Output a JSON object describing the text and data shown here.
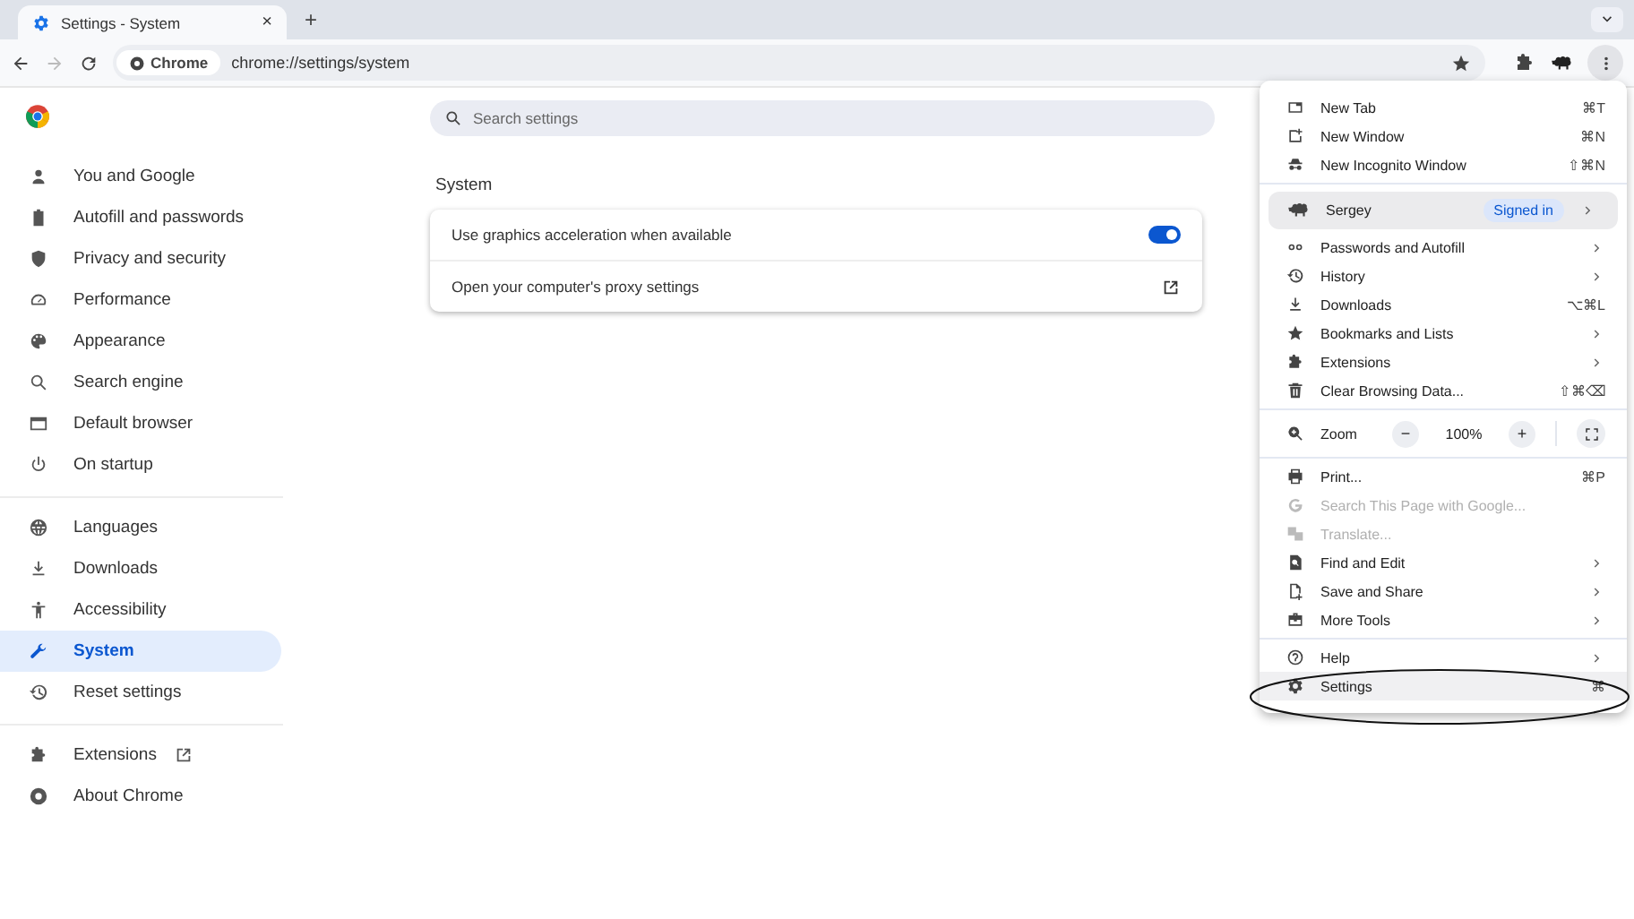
{
  "tabs": [
    {
      "title": "Settings - System",
      "selected": true,
      "close": "×"
    }
  ],
  "new_tab": "+",
  "toolbar": {
    "chip": "Chrome",
    "url": "chrome://settings/system",
    "forward_disabled": true
  },
  "sidebar": {
    "groups": [
      [
        {
          "label": "You and Google",
          "selected": false
        },
        {
          "label": "Autofill and passwords",
          "selected": false
        },
        {
          "label": "Privacy and security",
          "selected": false
        },
        {
          "label": "Performance",
          "selected": false
        },
        {
          "label": "Appearance",
          "selected": false
        },
        {
          "label": "Search engine",
          "selected": false
        },
        {
          "label": "Default browser",
          "selected": false
        },
        {
          "label": "On startup",
          "selected": false
        }
      ],
      [
        {
          "label": "Languages",
          "selected": false
        },
        {
          "label": "Downloads",
          "selected": false
        },
        {
          "label": "Accessibility",
          "selected": false
        },
        {
          "label": "System",
          "selected": true
        },
        {
          "label": "Reset settings",
          "selected": false
        }
      ],
      [
        {
          "label": "Extensions",
          "selected": false,
          "kind": "external"
        },
        {
          "label": "About Chrome",
          "selected": false,
          "kind": "page"
        }
      ]
    ]
  },
  "search": {
    "placeholder": "Search settings"
  },
  "section": {
    "title": "System",
    "rows": [
      {
        "kind": "toggle",
        "label": "Use graphics acceleration when available",
        "on": true
      },
      {
        "kind": "link",
        "label": "Open your computer's proxy settings"
      }
    ]
  },
  "menu": {
    "sections": [
      [
        {
          "kind": "item",
          "label": "New Tab",
          "shortcut": "⌘T"
        },
        {
          "kind": "item",
          "label": "New Window",
          "shortcut": "⌘N"
        },
        {
          "kind": "item",
          "label": "New Incognito Window",
          "shortcut": "⇧⌘N"
        }
      ],
      [
        {
          "kind": "profile",
          "label": "Sergey",
          "badge": "Signed in",
          "submenu": true
        },
        {
          "kind": "item",
          "label": "Passwords and Autofill",
          "submenu": true
        },
        {
          "kind": "item",
          "label": "History",
          "submenu": true
        },
        {
          "kind": "item",
          "label": "Downloads",
          "shortcut": "⌥⌘L"
        },
        {
          "kind": "item",
          "label": "Bookmarks and Lists",
          "submenu": true
        },
        {
          "kind": "item",
          "label": "Extensions",
          "submenu": true
        },
        {
          "kind": "item",
          "label": "Clear Browsing Data...",
          "shortcut": "⇧⌘⌫"
        }
      ],
      [
        {
          "kind": "zoom",
          "label": "Zoom",
          "minus": "−",
          "value": "100%",
          "plus": "+"
        }
      ],
      [
        {
          "kind": "item",
          "label": "Print...",
          "shortcut": "⌘P"
        },
        {
          "kind": "item",
          "label": "Search This Page with Google...",
          "disabled": true
        },
        {
          "kind": "item",
          "label": "Translate...",
          "disabled": true
        },
        {
          "kind": "item",
          "label": "Find and Edit",
          "submenu": true
        },
        {
          "kind": "item",
          "label": "Save and Share",
          "submenu": true
        },
        {
          "kind": "item",
          "label": "More Tools",
          "submenu": true
        }
      ],
      [
        {
          "kind": "item",
          "label": "Help",
          "submenu": true
        },
        {
          "kind": "item",
          "label": "Settings",
          "shortcut": "⌘",
          "highlighted": true,
          "circled": true
        }
      ]
    ]
  }
}
